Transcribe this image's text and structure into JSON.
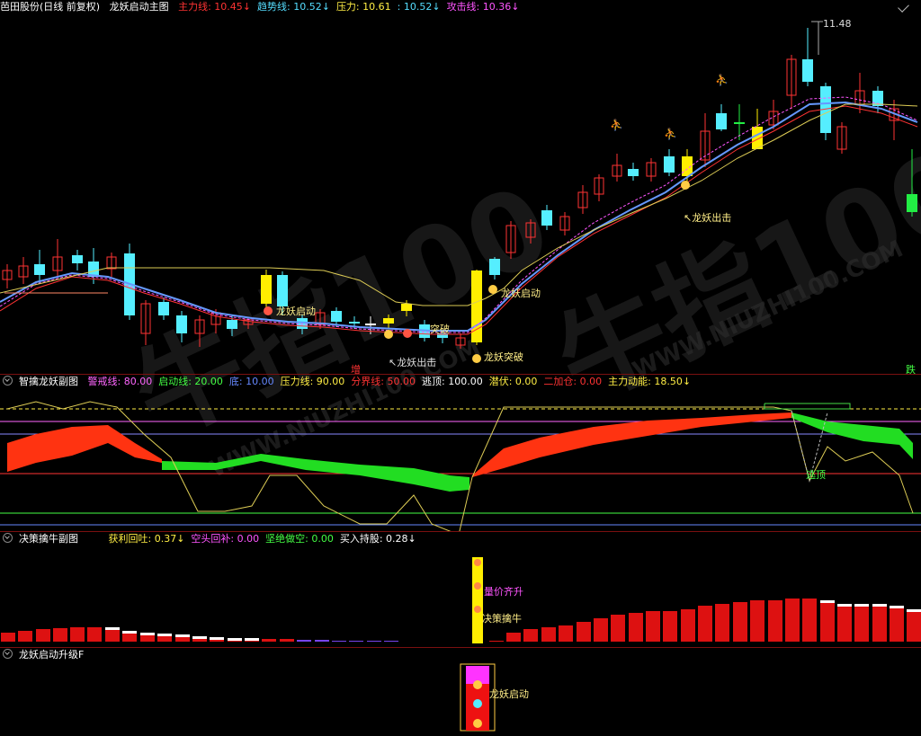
{
  "main": {
    "title": "芭田股份(日线 前复权)",
    "indicator": "龙妖启动主图",
    "fields": [
      {
        "label": "主力线:",
        "value": "10.45↓",
        "color": "#ff3333"
      },
      {
        "label": "趋势线:",
        "value": "10.52↓",
        "color": "#55ddff"
      },
      {
        "label": "压力:",
        "value": "10.61",
        "color": "#ffee44"
      },
      {
        "label": ":",
        "value": "10.52↓",
        "color": "#55ddff"
      },
      {
        "label": "攻击线:",
        "value": "10.36↓",
        "color": "#ff55ff"
      }
    ],
    "high_price": "11.48",
    "annotations": {
      "longyao_chuji_1": "↖龙妖出击",
      "longyao_chuji_2": "↖龙妖出击",
      "longyao_qidong_1": "龙妖启动",
      "longyao_qidong_2": "龙妖启动",
      "longyao_tupo_1": "突破",
      "longyao_tupo_2": "龙妖突破",
      "zeng": "增",
      "die": "跌"
    }
  },
  "sub1": {
    "title": "智擒龙妖副图",
    "fields": [
      {
        "label": "警戒线:",
        "value": "80.00",
        "color": "#ff66ff"
      },
      {
        "label": "启动线:",
        "value": "20.00",
        "color": "#44ff44"
      },
      {
        "label": "底:",
        "value": "10.00",
        "color": "#6688ff"
      },
      {
        "label": "压力线:",
        "value": "90.00",
        "color": "#ffee44"
      },
      {
        "label": "分界线:",
        "value": "50.00",
        "color": "#ff3333"
      },
      {
        "label": "逃顶:",
        "value": "100.00",
        "color": "#ffffff"
      },
      {
        "label": "潜伏:",
        "value": "0.00",
        "color": "#ffee44"
      },
      {
        "label": "二加仓:",
        "value": "0.00",
        "color": "#ff3333"
      },
      {
        "label": "主力动能:",
        "value": "18.50↓",
        "color": "#ffee44"
      }
    ],
    "escape_label": "逃顶"
  },
  "sub2": {
    "title": "决策擒牛副图",
    "fields": [
      {
        "label": "获利回吐:",
        "value": "0.37↓",
        "color": "#ffee44"
      },
      {
        "label": "空头回补:",
        "value": "0.00",
        "color": "#ff55ff"
      },
      {
        "label": "坚绝做空:",
        "value": "0.00",
        "color": "#44ff44"
      },
      {
        "label": "买入持股:",
        "value": "0.28↓",
        "color": "#ffffff"
      }
    ],
    "label_price_volume": "量价齐升",
    "label_decision": "决策擒牛"
  },
  "sub3": {
    "title": "龙妖启动升级F",
    "label_start": "龙妖启动"
  },
  "watermark": {
    "big": "牛指100",
    "url": "WWW.NIUZHI100.COM"
  },
  "colors": {
    "up": "#ff3333",
    "down": "#55eeff",
    "accent": "#ffee00"
  }
}
